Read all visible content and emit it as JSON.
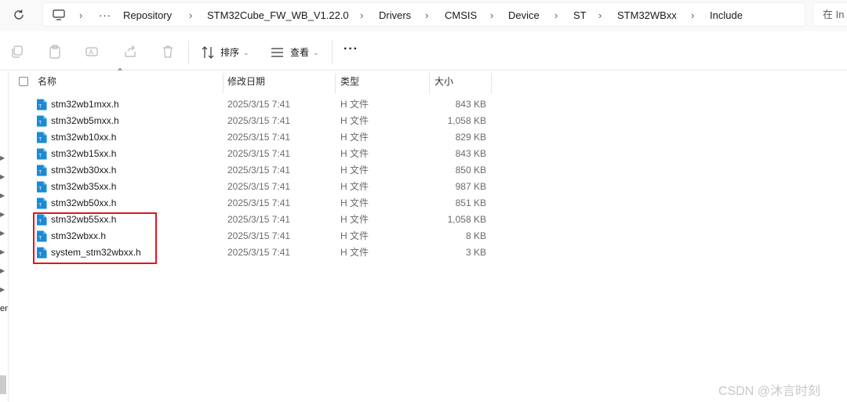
{
  "address_bar": {
    "refresh_icon": "refresh-icon",
    "pc_icon": "computer-icon",
    "overflow": "···",
    "breadcrumbs": [
      "Repository",
      "STM32Cube_FW_WB_V1.22.0",
      "Drivers",
      "CMSIS",
      "Device",
      "ST",
      "STM32WBxx",
      "Include"
    ],
    "search_placeholder": "在 In"
  },
  "toolbar": {
    "copy_icon": "copy-icon",
    "paste_icon": "paste-icon",
    "rename_icon": "rename-icon",
    "share_icon": "share-icon",
    "delete_icon": "delete-icon",
    "sort_label": "排序",
    "view_label": "查看",
    "more_label": "···"
  },
  "nav_pane": {
    "partial_text": "en"
  },
  "columns": {
    "name": "名称",
    "modified": "修改日期",
    "type": "类型",
    "size": "大小"
  },
  "files": [
    {
      "name": "stm32wb1mxx.h",
      "modified": "2025/3/15 7:41",
      "type": "H 文件",
      "size": "843 KB"
    },
    {
      "name": "stm32wb5mxx.h",
      "modified": "2025/3/15 7:41",
      "type": "H 文件",
      "size": "1,058 KB"
    },
    {
      "name": "stm32wb10xx.h",
      "modified": "2025/3/15 7:41",
      "type": "H 文件",
      "size": "829 KB"
    },
    {
      "name": "stm32wb15xx.h",
      "modified": "2025/3/15 7:41",
      "type": "H 文件",
      "size": "843 KB"
    },
    {
      "name": "stm32wb30xx.h",
      "modified": "2025/3/15 7:41",
      "type": "H 文件",
      "size": "850 KB"
    },
    {
      "name": "stm32wb35xx.h",
      "modified": "2025/3/15 7:41",
      "type": "H 文件",
      "size": "987 KB"
    },
    {
      "name": "stm32wb50xx.h",
      "modified": "2025/3/15 7:41",
      "type": "H 文件",
      "size": "851 KB"
    },
    {
      "name": "stm32wb55xx.h",
      "modified": "2025/3/15 7:41",
      "type": "H 文件",
      "size": "1,058 KB"
    },
    {
      "name": "stm32wbxx.h",
      "modified": "2025/3/15 7:41",
      "type": "H 文件",
      "size": "8 KB"
    },
    {
      "name": "system_stm32wbxx.h",
      "modified": "2025/3/15 7:41",
      "type": "H 文件",
      "size": "3 KB"
    }
  ],
  "file_icon": "text-file-icon",
  "file_icon_letter": "T",
  "highlight_color": "#e0161e",
  "watermark": "CSDN @沐言时刻"
}
